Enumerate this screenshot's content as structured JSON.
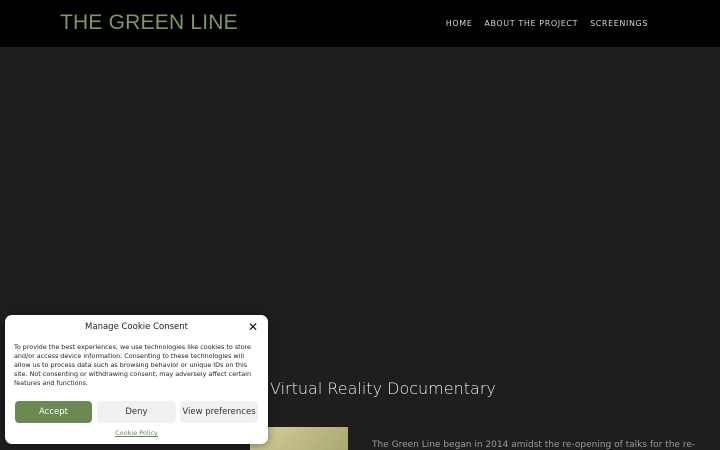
{
  "header": {
    "site_title": "THE GREEN LINE",
    "nav": [
      {
        "label": "HOME"
      },
      {
        "label": "ABOUT THE PROJECT"
      },
      {
        "label": "SCREENINGS"
      }
    ]
  },
  "main": {
    "section_heading": "Virtual Reality Documentary",
    "intro_text": "The Green Line began in 2014 amidst the re-opening of talks for the re-"
  },
  "cookie_dialog": {
    "title": "Manage Cookie Consent",
    "close_symbol": "✕",
    "body": "To provide the best experiences, we use technologies like cookies to store and/or access device information. Consenting to these technologies will allow us to process data such as browsing behavior or unique IDs on this site. Not consenting or withdrawing consent, may adversely affect certain features and functions.",
    "accept_label": "Accept",
    "deny_label": "Deny",
    "preferences_label": "View preferences",
    "policy_link": "Cookie Policy"
  },
  "colors": {
    "brand_green": "#7a9a5e",
    "accept_green": "#6a8a52",
    "header_bg": "#000000",
    "page_bg": "#1e1e1e"
  }
}
